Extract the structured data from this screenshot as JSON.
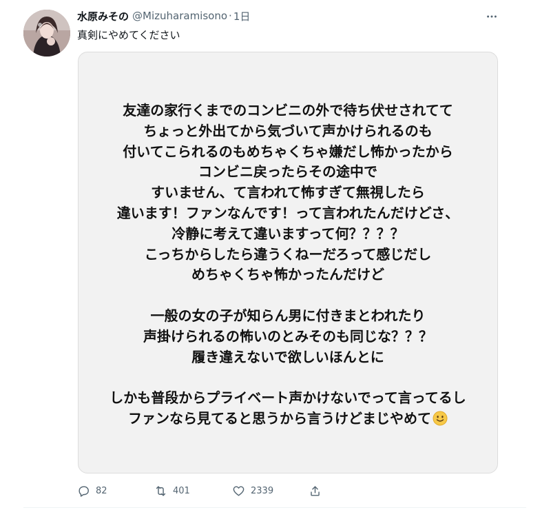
{
  "tweet": {
    "display_name": "水原みその",
    "handle": "@Mizuharamisono",
    "separator": "·",
    "time": "1日",
    "text": "真剣にやめてください",
    "more_icon": "more-icon"
  },
  "media": {
    "lines": [
      "友達の家行くまでのコンビニの外で待ち伏せされてて",
      "ちょっと外出てから気づいて声かけられるのも",
      "付いてこられるのもめちゃくちゃ嫌だし怖かったから",
      "コンビニ戻ったらその途中で",
      "すいません、て言われて怖すぎて無視したら",
      "違います！ファンなんです！って言われたんだけどさ、",
      "冷静に考えて違いますって何？？？？",
      "こっちからしたら違うくねーだろって感じだし",
      "めちゃくちゃ怖かったんだけど",
      "",
      "一般の女の子が知らん男に付きまとわれたり",
      "声掛けられるの怖いのとみそのも同じな？？？",
      "履き違えないで欲しいほんとに",
      "",
      "しかも普段からプライベート声かけないでって言ってるし",
      "ファンなら見てると思うから言うけどまじやめて"
    ],
    "emoji": "slightly-smiling-face-icon"
  },
  "actions": {
    "reply_count": "82",
    "retweet_count": "401",
    "like_count": "2339",
    "reply_icon": "reply-icon",
    "retweet_icon": "retweet-icon",
    "like_icon": "heart-icon",
    "share_icon": "share-icon"
  },
  "colors": {
    "text_primary": "#0f1419",
    "text_secondary": "#536471",
    "media_bg": "#f2f2f2"
  }
}
